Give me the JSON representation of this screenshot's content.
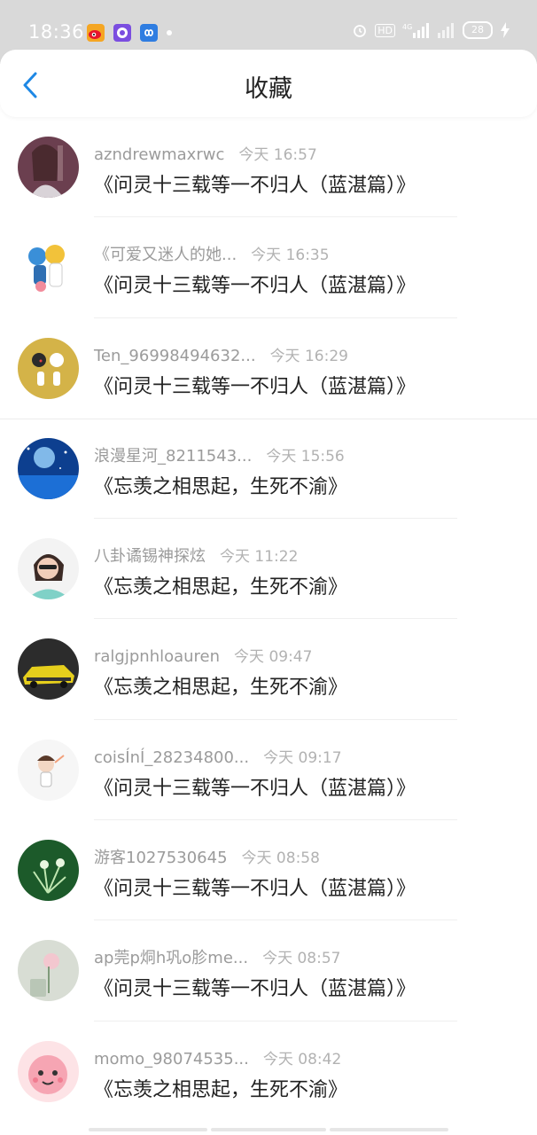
{
  "status_bar": {
    "time": "18:36",
    "battery": "28",
    "network": "4G",
    "hd": "HD"
  },
  "header": {
    "title": "收藏",
    "back_icon": "chevron-left-icon",
    "accent": "#1e88e5"
  },
  "items": [
    {
      "user": "azndrewmaxrwc",
      "time": "今天 16:57",
      "work": "《问灵十三载等一不归人（蓝湛篇）》"
    },
    {
      "user": "《可爱又迷人的她...",
      "time": "今天 16:35",
      "work": "《问灵十三载等一不归人（蓝湛篇）》"
    },
    {
      "user": "Ten_96998494632...",
      "time": "今天 16:29",
      "work": "《问灵十三载等一不归人（蓝湛篇）》"
    },
    {
      "user": "浪漫星河_8211543...",
      "time": "今天 15:56",
      "work": "《忘羡之相思起，生死不渝》"
    },
    {
      "user": "八卦谲锡神探炫",
      "time": "今天 11:22",
      "work": "《忘羡之相思起，生死不渝》"
    },
    {
      "user": "ralgjpnhloauren",
      "time": "今天 09:47",
      "work": "《忘羡之相思起，生死不渝》"
    },
    {
      "user": "coisÍnÍ_28234800...",
      "time": "今天 09:17",
      "work": "《问灵十三载等一不归人（蓝湛篇）》"
    },
    {
      "user": "游客1027530645",
      "time": "今天 08:58",
      "work": "《问灵十三载等一不归人（蓝湛篇）》"
    },
    {
      "user": "ap莞p烔h巩o胗me...",
      "time": "今天 08:57",
      "work": "《问灵十三载等一不归人（蓝湛篇）》"
    },
    {
      "user": "momo_98074535...",
      "time": "今天 08:42",
      "work": "《忘羡之相思起，生死不渝》"
    }
  ]
}
